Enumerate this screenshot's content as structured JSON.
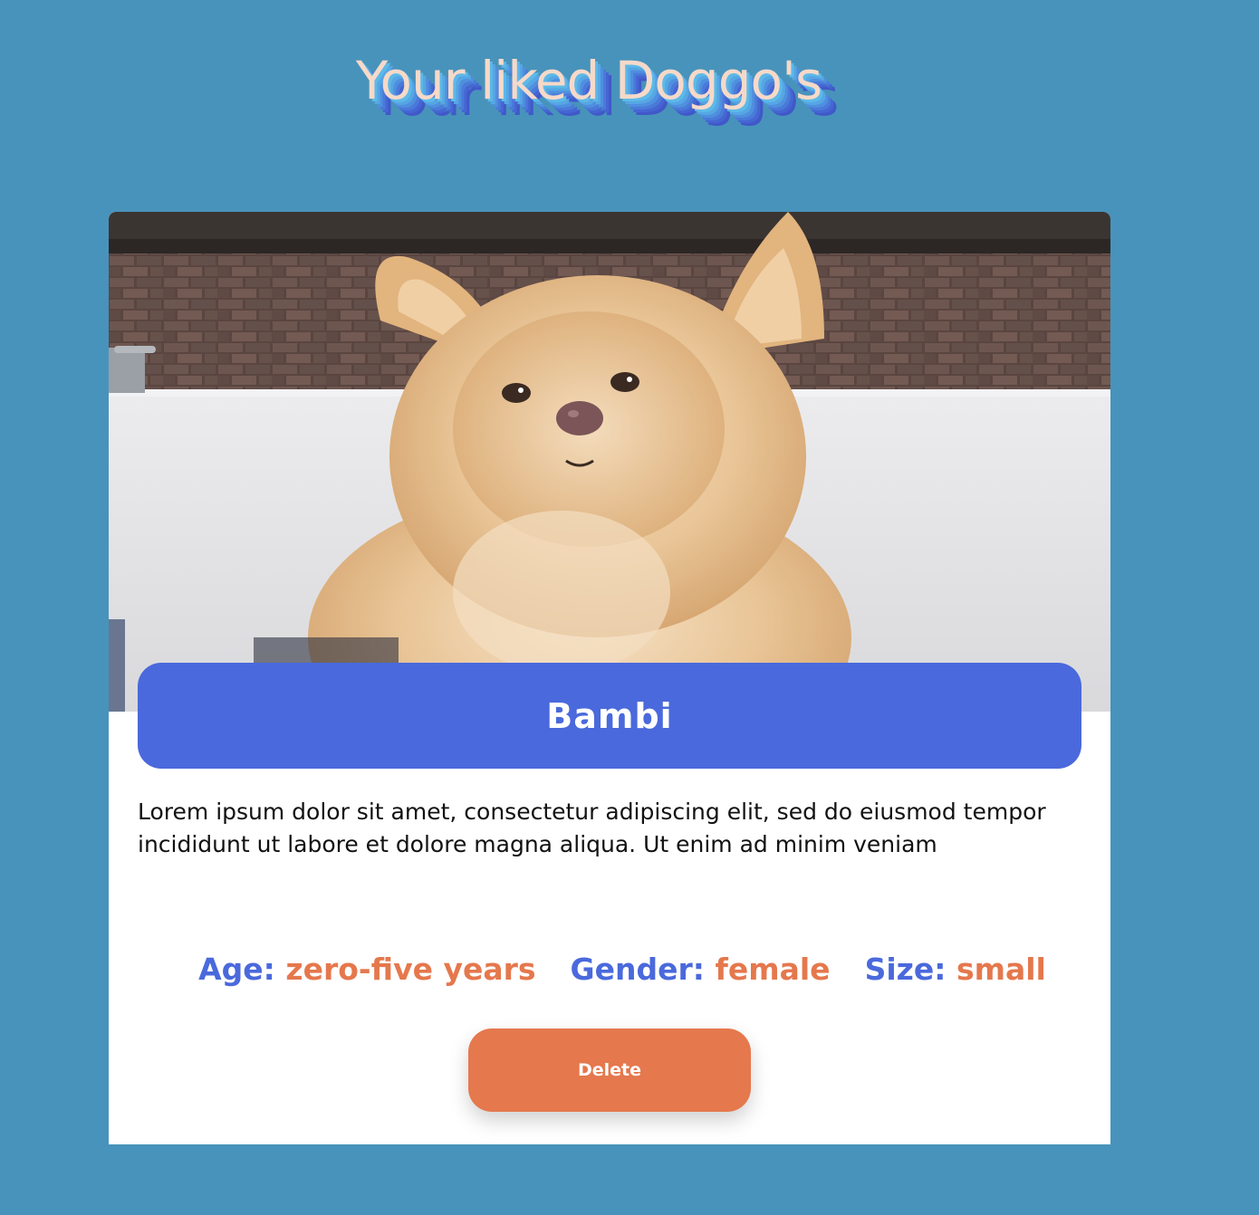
{
  "page": {
    "title": "Your liked Doggo's"
  },
  "card": {
    "image_alt": "Fluffy cream Pomeranian dog",
    "name": "Bambi",
    "description": "Lorem ipsum dolor sit amet, consectetur adipiscing elit, sed do eiusmod tempor incididunt ut labore et dolore magna aliqua. Ut enim ad minim veniam",
    "attributes": [
      {
        "label": "Age:",
        "value": "zero-five years"
      },
      {
        "label": "Gender:",
        "value": "female"
      },
      {
        "label": "Size:",
        "value": "small"
      }
    ],
    "delete_label": "Delete"
  },
  "colors": {
    "background": "#4893bb",
    "title_text": "#f6d9c9",
    "banner": "#4a69dc",
    "label": "#4a69dc",
    "value": "#e5784d",
    "delete_button": "#e5784d"
  }
}
